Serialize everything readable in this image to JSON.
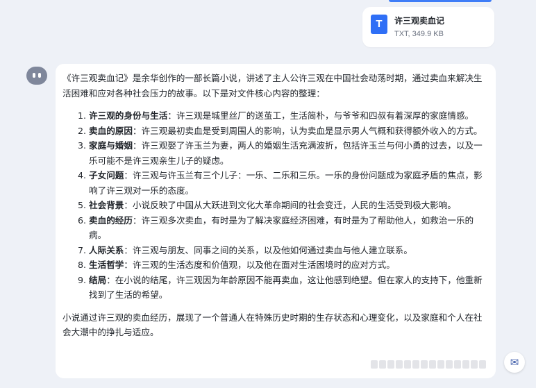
{
  "attachment": {
    "icon_letter": "T",
    "file_name": "许三观卖血记",
    "file_meta": "TXT, 349.9 KB",
    "icon_color": "#2f6ff6"
  },
  "assistant": {
    "avatar_icon": "bot-avatar-icon",
    "intro": "《许三观卖血记》是余华创作的一部长篇小说，讲述了主人公许三观在中国社会动荡时期，通过卖血来解决生活困难和应对各种社会压力的故事。以下是对文件核心内容的整理：",
    "points": [
      {
        "term": "许三观的身份与生活",
        "text": "：许三观是城里丝厂的送茧工，生活简朴，与爷爷和四叔有着深厚的家庭情感。"
      },
      {
        "term": "卖血的原因",
        "text": "：许三观最初卖血是受到周围人的影响，认为卖血是显示男人气概和获得额外收入的方式。"
      },
      {
        "term": "家庭与婚姻",
        "text": "：许三观娶了许玉兰为妻，两人的婚姻生活充满波折，包括许玉兰与何小勇的过去，以及一乐可能不是许三观亲生儿子的疑虑。"
      },
      {
        "term": "子女问题",
        "text": "：许三观与许玉兰有三个儿子：一乐、二乐和三乐。一乐的身份问题成为家庭矛盾的焦点，影响了许三观对一乐的态度。"
      },
      {
        "term": "社会背景",
        "text": "：小说反映了中国从大跃进到文化大革命期间的社会变迁，人民的生活受到极大影响。"
      },
      {
        "term": "卖血的经历",
        "text": "：许三观多次卖血，有时是为了解决家庭经济困难，有时是为了帮助他人，如救治一乐的病。"
      },
      {
        "term": "人际关系",
        "text": "：许三观与朋友、同事之间的关系，以及他如何通过卖血与他人建立联系。"
      },
      {
        "term": "生活哲学",
        "text": "：许三观的生活态度和价值观，以及他在面对生活困境时的应对方式。"
      },
      {
        "term": "结局",
        "text": "：在小说的结尾，许三观因为年龄原因不能再卖血，这让他感到绝望。但在家人的支持下，他重新找到了生活的希望。"
      }
    ],
    "conclusion": "小说通过许三观的卖血经历，展现了一个普通人在特殊历史时期的生存状态和心理变化，以及家庭和个人在社会大潮中的挣扎与适应。"
  },
  "floating": {
    "mail_icon": "✉"
  }
}
